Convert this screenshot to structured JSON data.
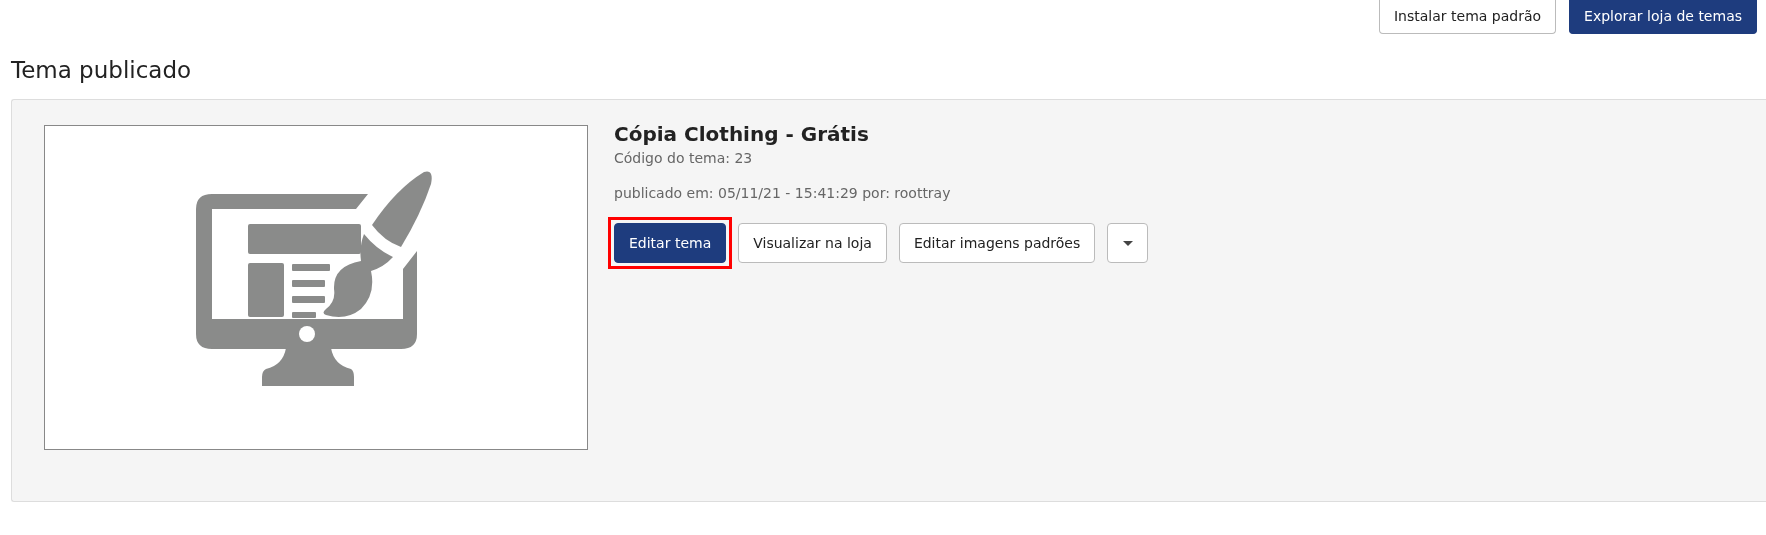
{
  "header_buttons": [
    {
      "label": "Instalar tema padrão",
      "kind": "outline"
    },
    {
      "label": "Explorar loja de temas",
      "kind": "primary"
    }
  ],
  "section_title": "Tema publicado",
  "theme": {
    "name": "Cópia Clothing - Grátis",
    "code": "Código do tema: 23",
    "published": "publicado em: 05/11/21 - 15:41:29 por: roottray",
    "actions": [
      {
        "label": "Editar tema",
        "kind": "primary",
        "highlighted": true
      },
      {
        "label": "Visualizar na loja",
        "kind": "outline",
        "highlighted": false
      },
      {
        "label": "Editar imagens padrões",
        "kind": "outline",
        "highlighted": false
      },
      {
        "kind": "dropdown",
        "highlighted": false
      }
    ]
  }
}
